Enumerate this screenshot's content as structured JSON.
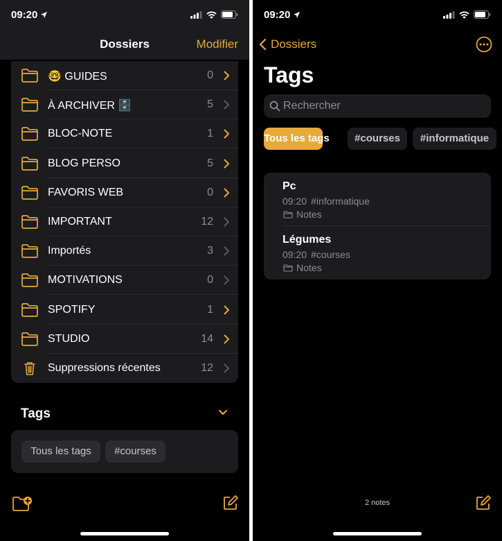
{
  "left": {
    "status": {
      "time": "09:20"
    },
    "nav": {
      "title": "Dossiers",
      "modify_label": "Modifier"
    },
    "folders": [
      {
        "name": "🤓 GUIDES",
        "count": "0",
        "chev_active": true,
        "icon": "folder-icon"
      },
      {
        "name": "À ARCHIVER 🗄️",
        "count": "5",
        "chev_active": false,
        "icon": "folder-icon"
      },
      {
        "name": "BLOC-NOTE",
        "count": "1",
        "chev_active": true,
        "icon": "folder-icon"
      },
      {
        "name": "BLOG PERSO",
        "count": "5",
        "chev_active": true,
        "icon": "folder-icon"
      },
      {
        "name": "FAVORIS WEB",
        "count": "0",
        "chev_active": true,
        "icon": "folder-icon"
      },
      {
        "name": "IMPORTANT",
        "count": "12",
        "chev_active": false,
        "icon": "folder-icon"
      },
      {
        "name": "Importés",
        "count": "3",
        "chev_active": false,
        "icon": "folder-icon"
      },
      {
        "name": "MOTIVATIONS",
        "count": "0",
        "chev_active": false,
        "icon": "folder-icon"
      },
      {
        "name": "SPOTIFY",
        "count": "1",
        "chev_active": true,
        "icon": "folder-icon"
      },
      {
        "name": "STUDIO",
        "count": "14",
        "chev_active": true,
        "icon": "folder-icon"
      },
      {
        "name": "Suppressions récentes",
        "count": "12",
        "chev_active": false,
        "icon": "trash-icon"
      }
    ],
    "tags_section": {
      "title": "Tags",
      "chips": [
        "Tous les tags",
        "#courses"
      ]
    }
  },
  "right": {
    "status": {
      "time": "09:20"
    },
    "nav": {
      "back_label": "Dossiers"
    },
    "title": "Tags",
    "search": {
      "placeholder": "Rechercher",
      "value": ""
    },
    "filters": [
      {
        "label": "Tous les tags",
        "active": true
      },
      {
        "label": "#courses",
        "active": false
      },
      {
        "label": "#informatique",
        "active": false
      }
    ],
    "notes": [
      {
        "title": "Pc",
        "time": "09:20",
        "tag": "#informatique",
        "folder": "Notes"
      },
      {
        "title": "Légumes",
        "time": "09:20",
        "tag": "#courses",
        "folder": "Notes"
      }
    ],
    "footer": {
      "count": "2 notes"
    }
  },
  "colors": {
    "accent": "#e8a93b",
    "background": "#000000",
    "card": "#1c1c1e",
    "chip": "#2c2c2e",
    "secondary_text": "#8e8e93"
  }
}
